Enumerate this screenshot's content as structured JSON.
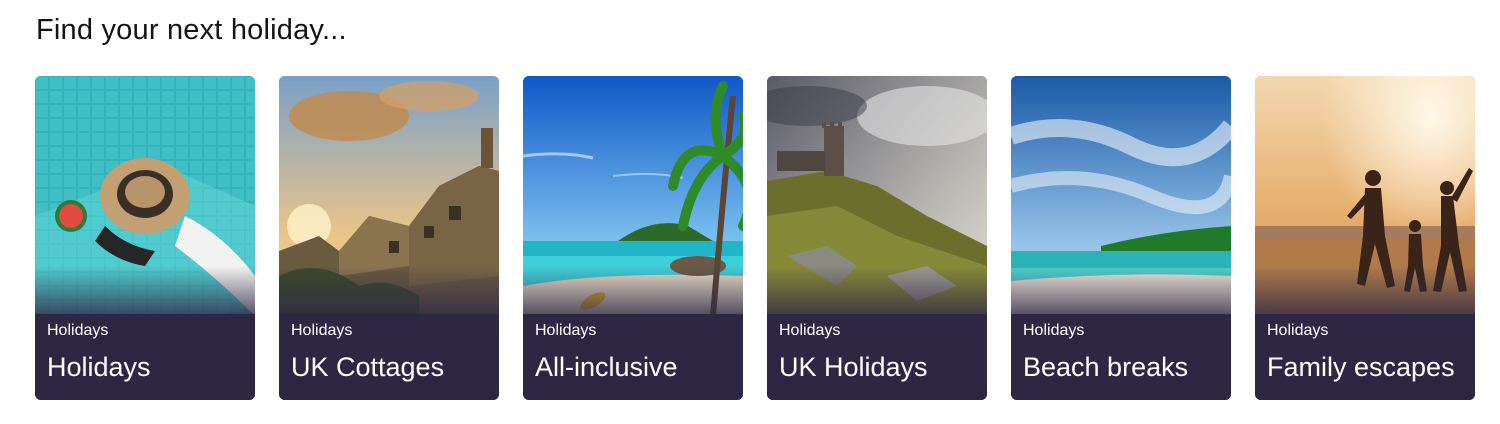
{
  "page": {
    "heading": "Find your next holiday..."
  },
  "cards": [
    {
      "category": "Holidays",
      "title": "Holidays",
      "scene": "pool-swimmer"
    },
    {
      "category": "Holidays",
      "title": "UK Cottages",
      "scene": "cotswold-cottages"
    },
    {
      "category": "Holidays",
      "title": "All-inclusive",
      "scene": "tropical-beach-palm"
    },
    {
      "category": "Holidays",
      "title": "UK Holidays",
      "scene": "hill-tower"
    },
    {
      "category": "Holidays",
      "title": "Beach breaks",
      "scene": "coastline-sky"
    },
    {
      "category": "Holidays",
      "title": "Family escapes",
      "scene": "family-sunset-beach"
    }
  ],
  "colors": {
    "card_band": "#2e2743",
    "text_on_band": "#ffffff",
    "heading": "#141414"
  }
}
